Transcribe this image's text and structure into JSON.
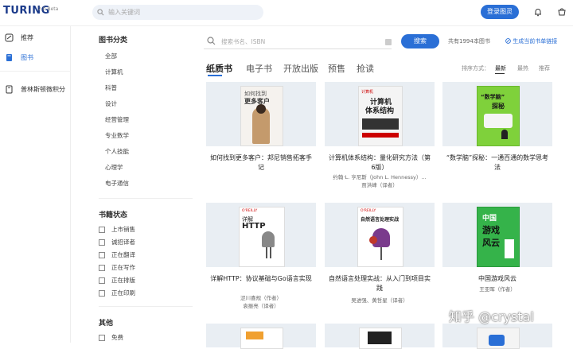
{
  "header": {
    "logo": "TURING",
    "version": "2.0 Beta",
    "search_placeholder": "输入关键词",
    "login_label": "登录图灵"
  },
  "leftnav": {
    "items": [
      {
        "label": "推荐"
      },
      {
        "label": "图书"
      },
      {
        "label": "普林斯顿微积分"
      }
    ]
  },
  "filters": {
    "category_title": "图书分类",
    "categories": [
      "全部",
      "计算机",
      "科普",
      "设计",
      "经营管理",
      "专业数学",
      "个人技能",
      "心理学",
      "电子通信"
    ],
    "status_title": "书籍状态",
    "statuses": [
      "上市销售",
      "诚招译者",
      "正在翻译",
      "正在写作",
      "正在排版",
      "正在印刷"
    ],
    "other_title": "其他",
    "others": [
      "免费"
    ]
  },
  "main": {
    "search_placeholder": "搜索书名、ISBN",
    "search_button": "搜索",
    "count_text": "共有1994本图书",
    "link_text": "生成当前书单链接",
    "tabs": [
      "纸质书",
      "电子书",
      "开放出版",
      "预售",
      "抢读"
    ],
    "sort_label": "排序方式：",
    "sort_options": [
      "最新",
      "最热",
      "推荐"
    ]
  },
  "books": [
    {
      "title": "如何找到更多客户：邦尼销售拓客手记",
      "authors": []
    },
    {
      "title": "计算机体系结构：量化研究方法（第6版）",
      "authors": [
        "约翰·L. 亨尼斯（John L. Hennessy）...",
        "贾洪峰（译者）"
      ]
    },
    {
      "title": "“数学脑”探秘：一通百通的数学思考法",
      "authors": []
    },
    {
      "title": "详解HTTP：协议基础与Go语言实现",
      "authors": [
        "涩川喜规（作者）",
        "袁振亮（译者）"
      ]
    },
    {
      "title": "自然语言处理实战：从入门到项目实践",
      "authors": [
        "吴进强、黄哲星（译者）"
      ]
    },
    {
      "title": "中国游戏风云",
      "authors": [
        "王亚晖（作者）"
      ]
    }
  ],
  "covers": {
    "b1": {
      "t1": "如何找到",
      "t2": "更多客户"
    },
    "b2": {
      "brand": "计算机",
      "t1": "计算机",
      "t2": "体系结构"
    },
    "b3": {
      "t1": "“数学脑”",
      "t2": "探秘"
    },
    "b4": {
      "brand": "O'REILLY",
      "t1": "详解",
      "t2": "HTTP"
    },
    "b5": {
      "brand": "O'REILLY",
      "t1": "自然语言处理实战"
    },
    "b6": {
      "t1": "中国",
      "t2": "游戏",
      "t3": "风云"
    }
  },
  "watermark": "知乎 @crystal",
  "colors": {
    "accent": "#2a6fd6"
  }
}
